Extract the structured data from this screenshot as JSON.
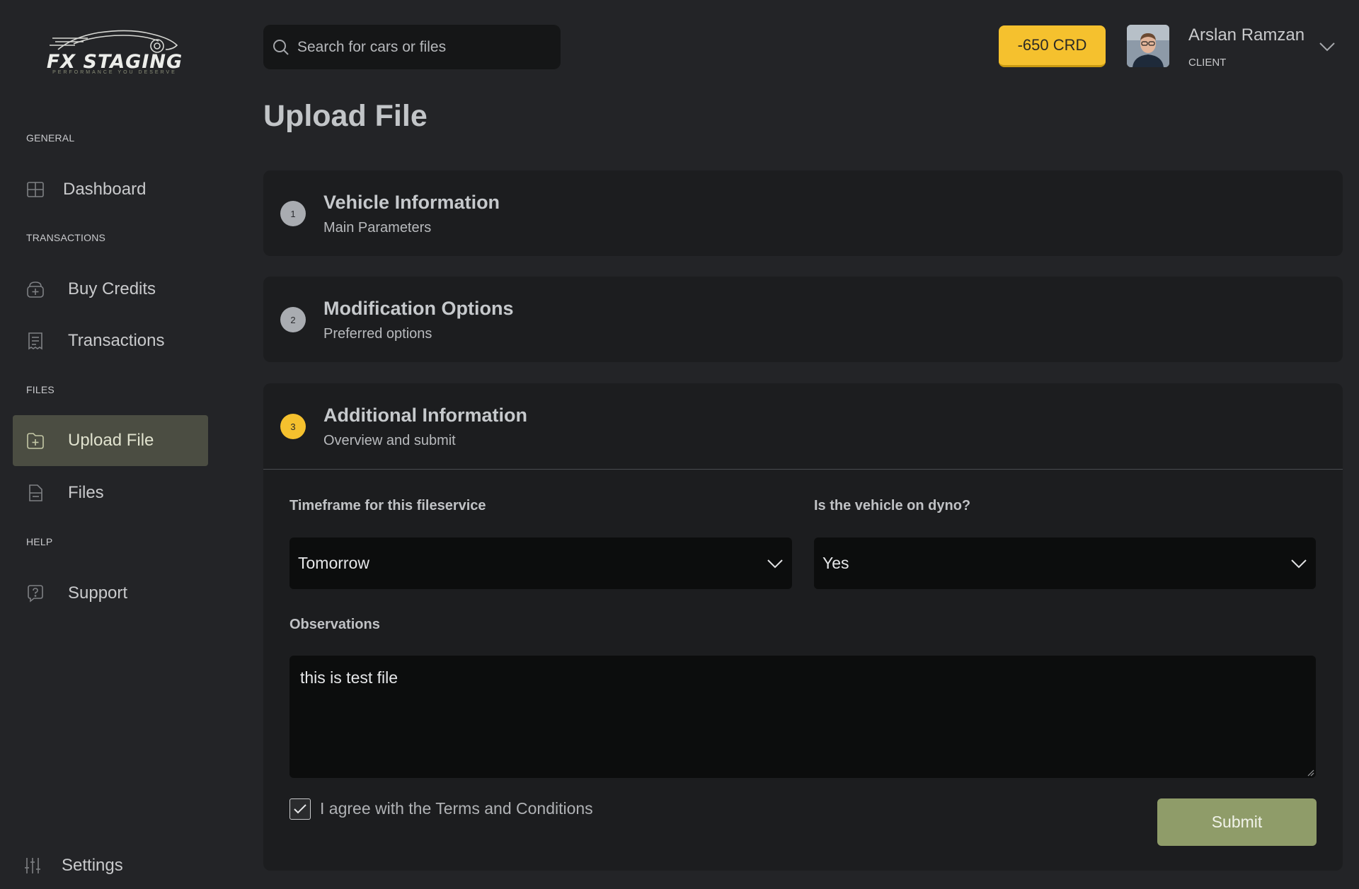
{
  "brand": {
    "name": "FX STAGING",
    "tagline": "PERFORMANCE YOU DESERVE"
  },
  "sidebar": {
    "sections": [
      {
        "title": "GENERAL"
      },
      {
        "title": "TRANSACTIONS"
      },
      {
        "title": "FILES"
      },
      {
        "title": "HELP"
      }
    ],
    "items": [
      {
        "label": "Dashboard",
        "icon": "grid-icon"
      },
      {
        "label": "Buy Credits",
        "icon": "credit-bag-icon"
      },
      {
        "label": "Transactions",
        "icon": "receipt-icon"
      },
      {
        "label": "Upload File",
        "icon": "folder-plus-icon",
        "active": true
      },
      {
        "label": "Files",
        "icon": "file-icon"
      },
      {
        "label": "Support",
        "icon": "help-chat-icon"
      }
    ],
    "settings_label": "Settings"
  },
  "topbar": {
    "search_placeholder": "Search for cars or files",
    "credits": "-650 CRD",
    "user_name": "Arslan Ramzan",
    "user_role": "CLIENT"
  },
  "page": {
    "title": "Upload File"
  },
  "steps": [
    {
      "number": "1",
      "title": "Vehicle Information",
      "subtitle": "Main Parameters"
    },
    {
      "number": "2",
      "title": "Modification Options",
      "subtitle": "Preferred options"
    },
    {
      "number": "3",
      "title": "Additional Information",
      "subtitle": "Overview and submit"
    }
  ],
  "form": {
    "timeframe_label": "Timeframe for this fileservice",
    "timeframe_value": "Tomorrow",
    "dyno_label": "Is the vehicle on dyno?",
    "dyno_value": "Yes",
    "observations_label": "Observations",
    "observations_value": "this is test file",
    "terms_label": "I agree with the Terms and Conditions",
    "terms_checked": true,
    "submit_label": "Submit"
  },
  "colors": {
    "accent_yellow": "#f5c12e",
    "submit_green": "#8f9c69",
    "active_nav": "#4b4d42"
  }
}
